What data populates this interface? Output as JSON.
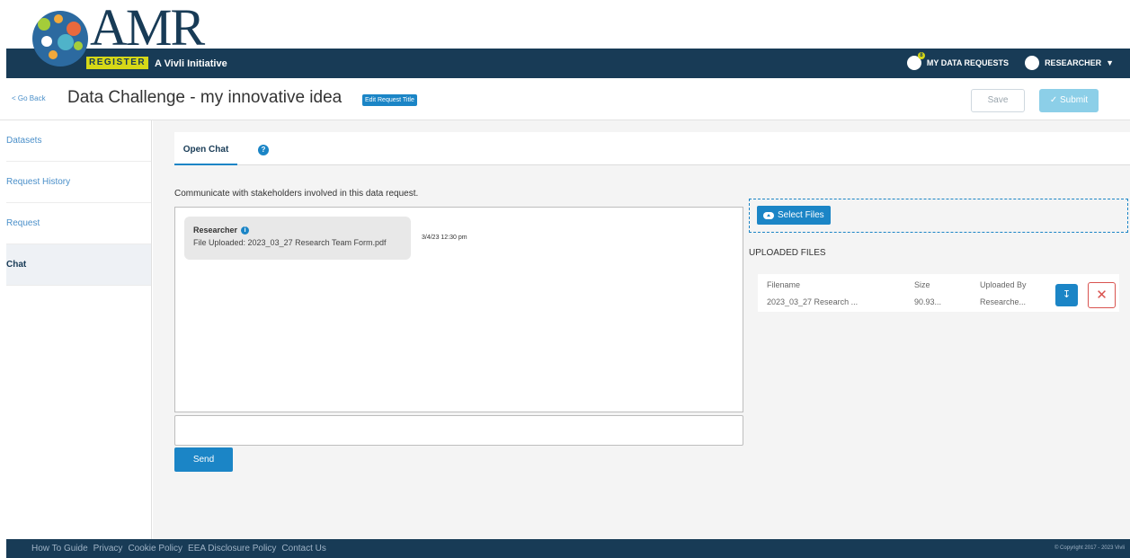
{
  "header": {
    "logo_text": "AMR",
    "register_text": "REGISTER",
    "tagline": "A Vivli Initiative",
    "my_data_requests": "MY DATA REQUESTS",
    "requests_badge": "8",
    "user_menu": "RESEARCHER"
  },
  "titlebar": {
    "go_back": "< Go Back",
    "title": "Data Challenge - my innovative idea",
    "edit_title": "Edit Request Title",
    "save": "Save",
    "submit": "Submit"
  },
  "sidebar": {
    "items": [
      {
        "label": "Datasets"
      },
      {
        "label": "Request History"
      },
      {
        "label": "Request"
      },
      {
        "label": "Chat"
      }
    ]
  },
  "tabs": {
    "open_chat": "Open Chat",
    "help": "?"
  },
  "chat": {
    "intro": "Communicate with stakeholders involved in this data request.",
    "messages": [
      {
        "author": "Researcher",
        "text": "File Uploaded: 2023_03_27 Research Team Form.pdf",
        "time": "3/4/23 12:30 pm"
      }
    ],
    "input_value": "",
    "send": "Send"
  },
  "files": {
    "select_files": "Select Files",
    "uploaded_title": "UPLOADED FILES",
    "columns": [
      "Filename",
      "Size",
      "Uploaded By"
    ],
    "rows": [
      [
        "2023_03_27 Research ...",
        "90.93...",
        "Researche..."
      ]
    ]
  },
  "footer": {
    "links": [
      "How To Guide",
      "Privacy",
      "Cookie Policy",
      "EEA Disclosure Policy",
      "Contact Us"
    ],
    "copyright": "© Copyright 2017 - 2023 Vivli"
  },
  "colors": {
    "navy": "#183b56",
    "accent": "#1b85c6",
    "lime": "#d6d817",
    "danger": "#d9534f"
  }
}
